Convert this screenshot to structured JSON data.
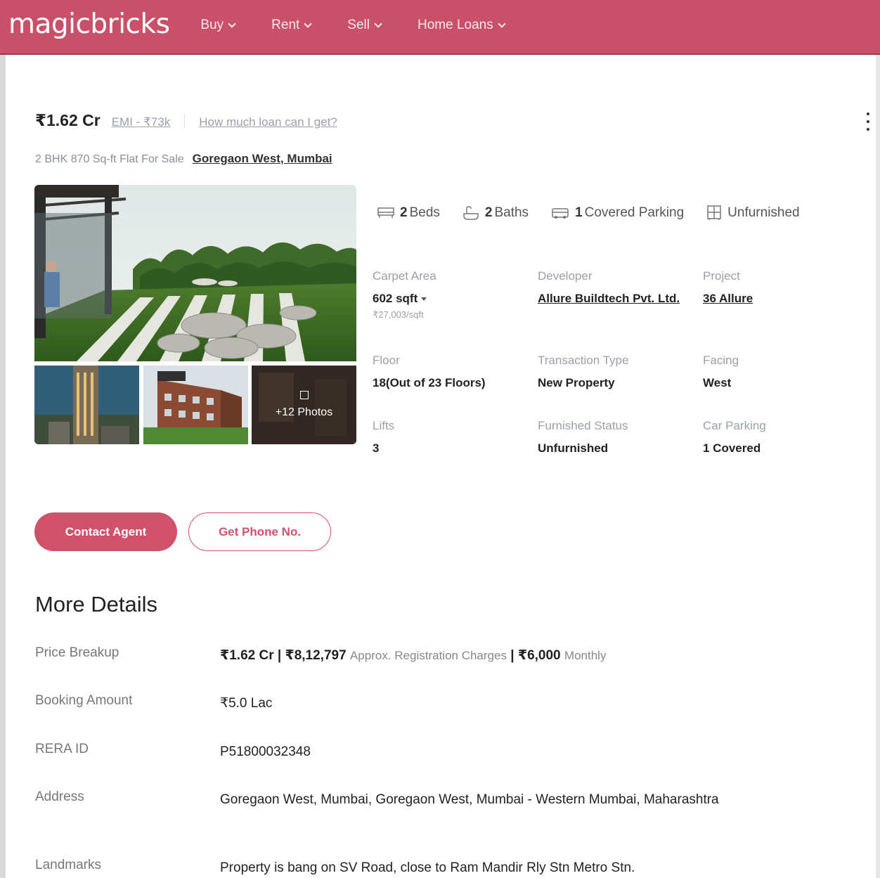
{
  "header": {
    "logo": "magicbricks",
    "nav": [
      {
        "label": "Buy"
      },
      {
        "label": "Rent"
      },
      {
        "label": "Sell"
      },
      {
        "label": "Home Loans"
      }
    ],
    "brand_color": "#c85069"
  },
  "listing": {
    "price": "₹1.62 Cr",
    "emi": "EMI - ₹73k",
    "loan_link": "How much loan can I get?",
    "subtitle": "2 BHK 870 Sq-ft Flat For Sale",
    "location": "Goregaon West, Mumbai",
    "more_photos": "+12 Photos"
  },
  "amenities": [
    {
      "icon": "bed-icon",
      "count": "2",
      "label": "Beds"
    },
    {
      "icon": "bath-icon",
      "count": "2",
      "label": "Baths"
    },
    {
      "icon": "car-icon",
      "count": "1",
      "label": "Covered Parking"
    },
    {
      "icon": "wardrobe-icon",
      "count": "",
      "label": "Unfurnished"
    }
  ],
  "specs": {
    "carpet_area": {
      "label": "Carpet Area",
      "value": "602 sqft",
      "sub": "₹27,003/sqft"
    },
    "developer": {
      "label": "Developer",
      "value": "Allure Buildtech Pvt. Ltd."
    },
    "project": {
      "label": "Project",
      "value": "36 Allure"
    },
    "floor": {
      "label": "Floor",
      "value": "18(Out of 23 Floors)"
    },
    "transaction": {
      "label": "Transaction Type",
      "value": "New Property"
    },
    "facing": {
      "label": "Facing",
      "value": "West"
    },
    "lifts": {
      "label": "Lifts",
      "value": "3"
    },
    "furnished": {
      "label": "Furnished Status",
      "value": "Unfurnished"
    },
    "car_parking": {
      "label": "Car Parking",
      "value": "1 Covered"
    }
  },
  "actions": {
    "contact": "Contact Agent",
    "phone": "Get Phone No."
  },
  "more_details": {
    "title": "More Details",
    "price_breakup": {
      "label": "Price Breakup",
      "price": "₹1.62 Cr |",
      "registration": "₹8,12,797",
      "registration_note": "Approx. Registration Charges",
      "monthly_sep": "|",
      "monthly": "₹6,000",
      "monthly_note": "Monthly"
    },
    "booking": {
      "label": "Booking Amount",
      "value": "₹5.0 Lac"
    },
    "rera": {
      "label": "RERA ID",
      "value": "P51800032348"
    },
    "address": {
      "label": "Address",
      "value": "Goregaon West, Mumbai, Goregaon West, Mumbai - Western Mumbai, Maharashtra"
    },
    "landmarks": {
      "label": "Landmarks",
      "value": "Property is bang on SV Road, close to Ram Mandir Rly Stn Metro Stn."
    }
  }
}
